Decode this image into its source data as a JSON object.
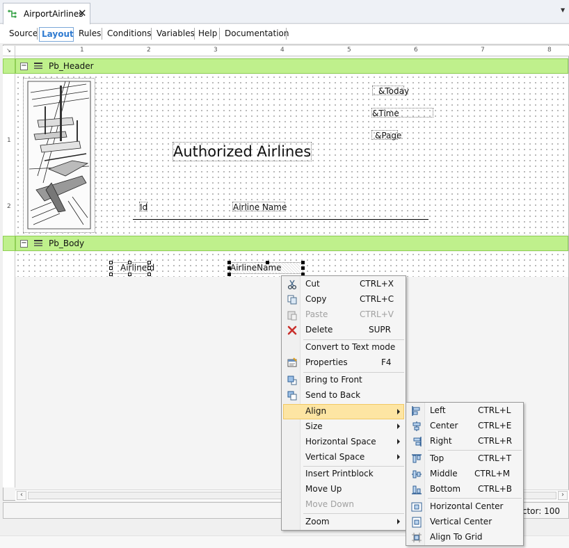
{
  "document_tab": {
    "title": "AirportAirlines"
  },
  "subtabs": [
    "Source",
    "Layout",
    "Rules",
    "Conditions",
    "Variables",
    "Help",
    "Documentation"
  ],
  "active_subtab": "Layout",
  "ruler": {
    "marks": [
      "1",
      "2",
      "3",
      "4",
      "5",
      "6",
      "7",
      "8"
    ],
    "vmarks": [
      "1",
      "2"
    ]
  },
  "bands": {
    "header": {
      "name": "Pb_Header"
    },
    "body": {
      "name": "Pb_Body"
    }
  },
  "header_controls": {
    "today": "&Today",
    "time": "&Time",
    "page": "&Page",
    "title": "Authorized Airlines",
    "col_id": "Id",
    "col_name": "Airline Name"
  },
  "body_controls": {
    "airline_id": "AirlineId",
    "airline_name": "AirlineName"
  },
  "status": {
    "text": "actor: 100"
  },
  "context_menu": {
    "items": [
      {
        "label": "Cut",
        "shortcut": "CTRL+X",
        "icon": "scissors-icon",
        "enabled": true
      },
      {
        "label": "Copy",
        "shortcut": "CTRL+C",
        "icon": "copy-icon",
        "enabled": true
      },
      {
        "label": "Paste",
        "shortcut": "CTRL+V",
        "icon": "paste-icon",
        "enabled": false
      },
      {
        "label": "Delete",
        "shortcut": "SUPR",
        "icon": "delete-icon",
        "enabled": true
      },
      {
        "label": "Convert to Text mode",
        "shortcut": "",
        "icon": "",
        "enabled": true
      },
      {
        "label": "Properties",
        "shortcut": "F4",
        "icon": "properties-icon",
        "enabled": true
      },
      {
        "label": "Bring to Front",
        "shortcut": "",
        "icon": "bring-to-front-icon",
        "enabled": true
      },
      {
        "label": "Send to Back",
        "shortcut": "",
        "icon": "send-to-back-icon",
        "enabled": true
      },
      {
        "label": "Align",
        "shortcut": "",
        "icon": "",
        "enabled": true,
        "submenu": true,
        "highlighted": true
      },
      {
        "label": "Size",
        "shortcut": "",
        "icon": "",
        "enabled": true,
        "submenu": true
      },
      {
        "label": "Horizontal Space",
        "shortcut": "",
        "icon": "",
        "enabled": true,
        "submenu": true
      },
      {
        "label": "Vertical Space",
        "shortcut": "",
        "icon": "",
        "enabled": true,
        "submenu": true
      },
      {
        "label": "Insert Printblock",
        "shortcut": "",
        "icon": "",
        "enabled": true
      },
      {
        "label": "Move Up",
        "shortcut": "",
        "icon": "",
        "enabled": true
      },
      {
        "label": "Move Down",
        "shortcut": "",
        "icon": "",
        "enabled": false
      },
      {
        "label": "Zoom",
        "shortcut": "",
        "icon": "",
        "enabled": true,
        "submenu": true
      }
    ]
  },
  "align_submenu": {
    "items": [
      {
        "label": "Left",
        "shortcut": "CTRL+L",
        "icon": "align-left-icon"
      },
      {
        "label": "Center",
        "shortcut": "CTRL+E",
        "icon": "align-center-icon"
      },
      {
        "label": "Right",
        "shortcut": "CTRL+R",
        "icon": "align-right-icon"
      },
      {
        "label": "Top",
        "shortcut": "CTRL+T",
        "icon": "align-top-icon"
      },
      {
        "label": "Middle",
        "shortcut": "CTRL+M",
        "icon": "align-middle-icon"
      },
      {
        "label": "Bottom",
        "shortcut": "CTRL+B",
        "icon": "align-bottom-icon"
      },
      {
        "label": "Horizontal Center",
        "shortcut": "",
        "icon": "horizontal-center-icon"
      },
      {
        "label": "Vertical Center",
        "shortcut": "",
        "icon": "vertical-center-icon"
      },
      {
        "label": "Align To Grid",
        "shortcut": "",
        "icon": "align-to-grid-icon"
      }
    ]
  }
}
